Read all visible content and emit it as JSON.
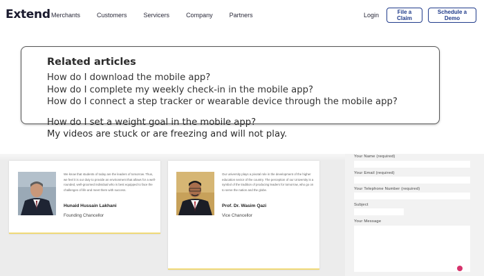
{
  "header": {
    "logo": "Extend",
    "nav": [
      "Merchants",
      "Customers",
      "Servicers",
      "Company",
      "Partners"
    ],
    "login": "Login",
    "file_claim": "File a Claim",
    "schedule_demo": "Schedule a Demo",
    "accent_color": "#1e3a8a"
  },
  "related": {
    "title": "Related articles",
    "articles": [
      "How do I download the mobile app?",
      "How do I complete my weekly check-in in the mobile app?",
      "How do I connect a step tracker or wearable device through the mobile app?",
      "How do I set a weight goal in the mobile app?",
      "My videos are stuck or are freezing and will not play."
    ]
  },
  "people": [
    {
      "quote": "We know that students of today are the leaders of tomorrow. Thus, we feel it is our duty to provide an environment that allows for a well-rounded, well-groomed individual who is best equipped to face the challenges of life and meet them with success.",
      "name": "Hunaid Hussain Lakhani",
      "title": "Founding Chancellor"
    },
    {
      "quote": "Our university plays a pivotal role in the development of the higher education sector of the country. The perception of our University is a symbol of the tradition of producing leaders for tomorrow, who go on to serve the nation and the globe.",
      "name": "Prof. Dr. Wasim Qazi",
      "title": "Vice Chancellor"
    }
  ],
  "form": {
    "name_label": "Your Name (required)",
    "email_label": "Your Email (required)",
    "phone_label": "Your Telephone Number (required)",
    "subject_label": "Subject",
    "message_label": "Your Message"
  }
}
